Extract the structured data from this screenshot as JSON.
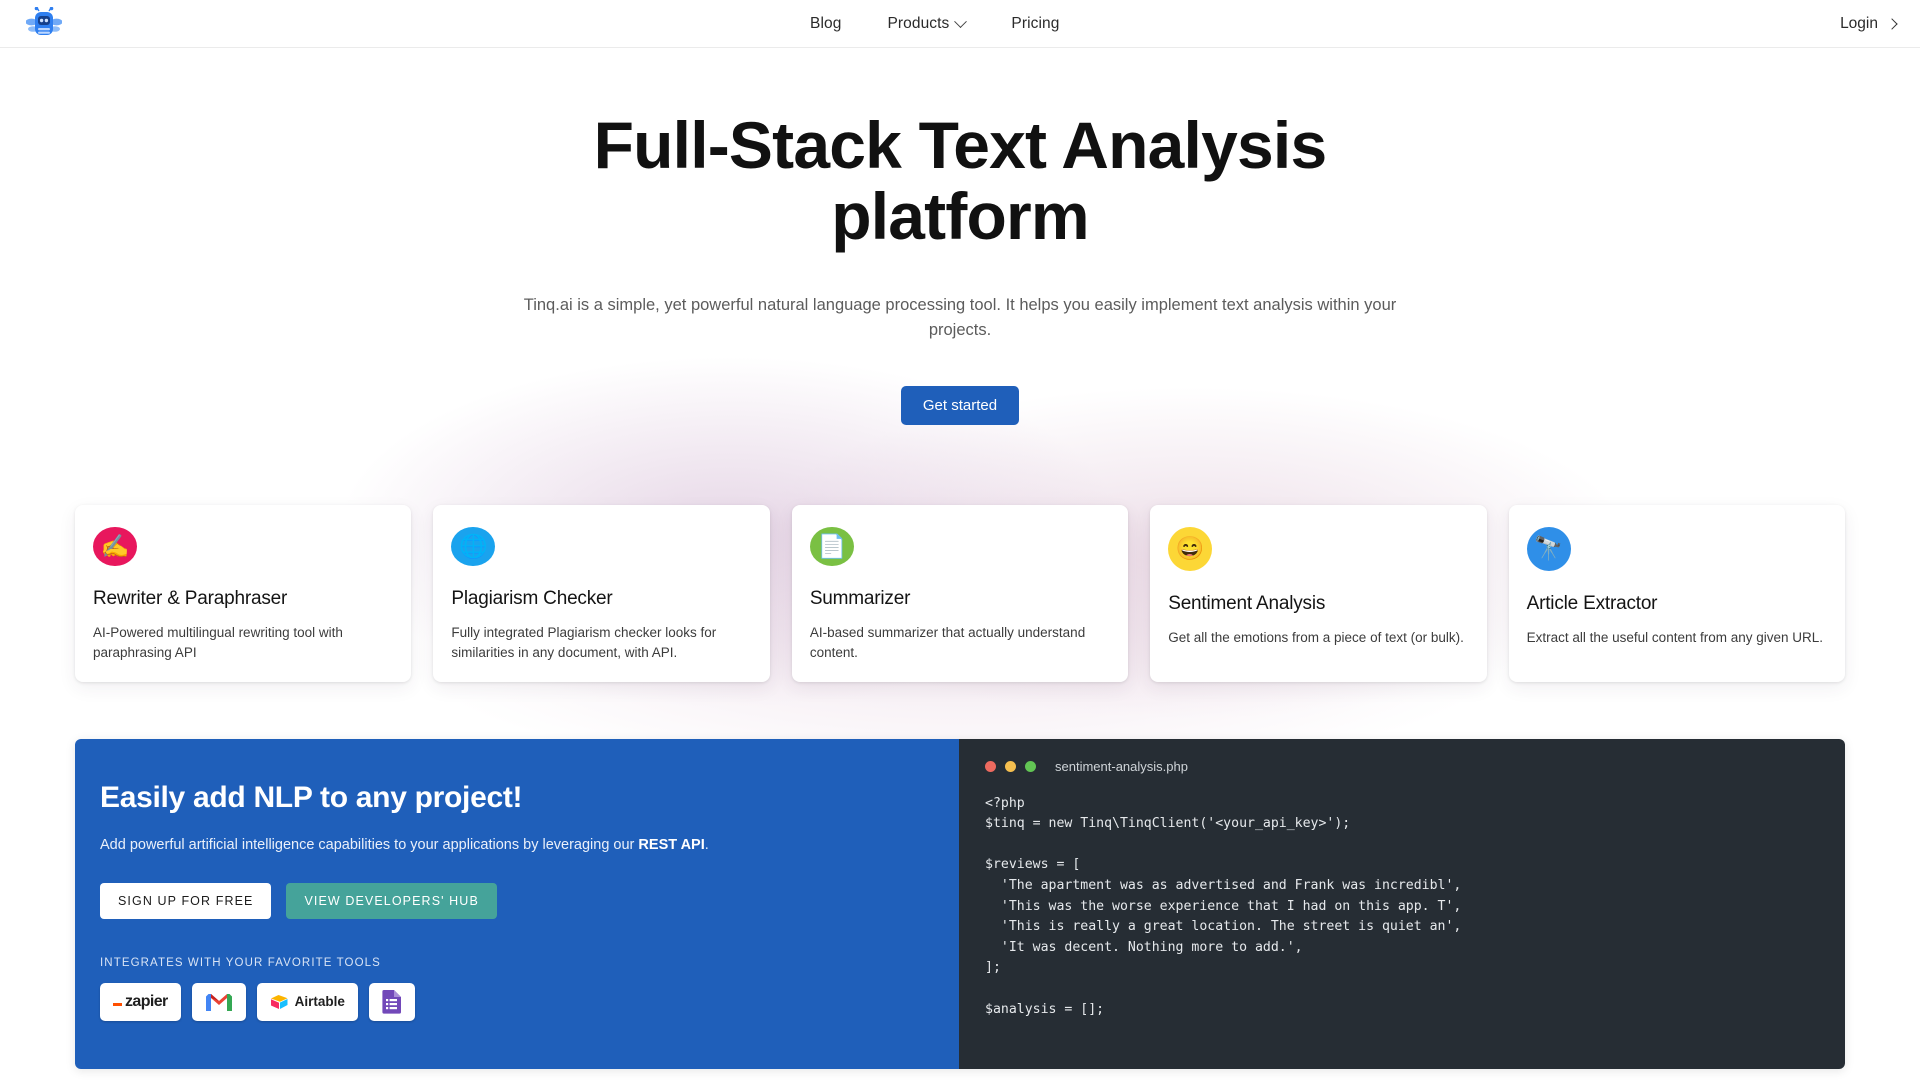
{
  "nav": {
    "logo_icon": "bee-robot-logo",
    "links": [
      {
        "label": "Blog",
        "has_chevron": false
      },
      {
        "label": "Products",
        "has_chevron": true
      },
      {
        "label": "Pricing",
        "has_chevron": false
      }
    ],
    "login_label": "Login"
  },
  "hero": {
    "title": "Full-Stack Text Analysis platform",
    "subtitle": "Tinq.ai is a simple, yet powerful natural language processing tool. It helps you easily implement text analysis within your projects.",
    "cta_label": "Get started",
    "cta_color": "#1f5fba"
  },
  "cards": [
    {
      "icon": "✍️",
      "icon_name": "writing-hand-icon",
      "icon_bg": "#e8175d",
      "title": "Rewriter & Paraphraser",
      "desc": "AI-Powered multilingual rewriting tool with paraphrasing API"
    },
    {
      "icon": "🌐",
      "icon_name": "globe-icon",
      "icon_bg": "#1aa3ee",
      "title": "Plagiarism Checker",
      "desc": "Fully integrated Plagiarism checker looks for similarities in any document, with API."
    },
    {
      "icon": "📄",
      "icon_name": "document-icon",
      "icon_bg": "#7ac043",
      "title": "Summarizer",
      "desc": "AI-based summarizer that actually understand content."
    },
    {
      "icon": "😄",
      "icon_name": "smiling-face-icon",
      "icon_bg": "#fcd736",
      "title": "Sentiment Analysis",
      "desc": "Get all the emotions from a piece of text (or bulk)."
    },
    {
      "icon": "🔭",
      "icon_name": "telescope-icon",
      "icon_bg": "#2f8fe8",
      "title": "Article Extractor",
      "desc": "Extract all the useful content from any given URL."
    }
  ],
  "panel": {
    "bg_color": "#1f5fba",
    "title": "Easily add NLP to any project!",
    "subtitle_prefix": "Add powerful artificial intelligence capabilities to your applications by leveraging our ",
    "subtitle_strong": "REST API",
    "subtitle_suffix": ".",
    "signup_label": "SIGN UP FOR FREE",
    "devhub_label": "VIEW DEVELOPERS' HUB",
    "devhub_color": "#45a39a",
    "integrates_label": "INTEGRATES WITH YOUR FAVORITE TOOLS",
    "logos": [
      {
        "name": "zapier-logo",
        "label": "zapier"
      },
      {
        "name": "gmail-logo",
        "label": "M"
      },
      {
        "name": "airtable-logo",
        "label": "Airtable"
      },
      {
        "name": "google-forms-logo",
        "label": ""
      }
    ]
  },
  "code": {
    "filename": "sentiment-analysis.php",
    "dots": [
      "red",
      "yellow",
      "green"
    ],
    "content": "<?php\n$tinq = new Tinq\\TinqClient('<your_api_key>');\n\n$reviews = [\n  'The apartment was as advertised and Frank was incredibl',\n  'This was the worse experience that I had on this app. T',\n  'This is really a great location. The street is quiet an',\n  'It was decent. Nothing more to add.',\n];\n\n$analysis = [];"
  }
}
